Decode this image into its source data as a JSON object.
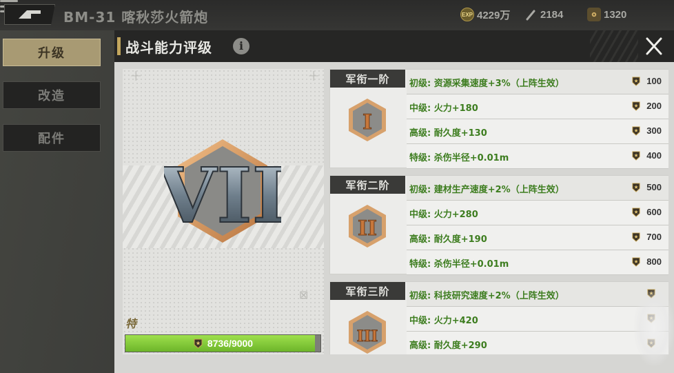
{
  "header": {
    "unit_title": "BM-31 喀秋莎火箭炮",
    "resources": {
      "exp_icon": "EXP",
      "exp_value": "4229万",
      "parts_value": "2184",
      "medal_value": "1320"
    }
  },
  "sidebar": {
    "items": [
      {
        "label": "升级",
        "active": true
      },
      {
        "label": "改造",
        "active": false
      },
      {
        "label": "配件",
        "active": false
      }
    ]
  },
  "modal": {
    "title": "战斗能力评级",
    "info_icon": "i",
    "current_rank_numeral": "VII",
    "current_rank_label": "特级",
    "progress": {
      "current": 8736,
      "max": 9000,
      "text": "8736/9000",
      "fraction": 0.9707
    },
    "tiers": [
      {
        "title": "军衔一阶",
        "numeral": "I",
        "rows": [
          {
            "text": "初级: 资源采集速度+3%（上阵生效）",
            "cost": "100"
          },
          {
            "text": "中级: 火力+180",
            "cost": "200"
          },
          {
            "text": "高级: 耐久度+130",
            "cost": "300"
          },
          {
            "text": "特级: 杀伤半径+0.01m",
            "cost": "400"
          }
        ]
      },
      {
        "title": "军衔二阶",
        "numeral": "II",
        "rows": [
          {
            "text": "初级: 建材生产速度+2%（上阵生效）",
            "cost": "500"
          },
          {
            "text": "中级: 火力+280",
            "cost": "600"
          },
          {
            "text": "高级: 耐久度+190",
            "cost": "700"
          },
          {
            "text": "特级: 杀伤半径+0.01m",
            "cost": "800"
          }
        ]
      },
      {
        "title": "军衔三阶",
        "numeral": "III",
        "rows": [
          {
            "text": "初级: 科技研究速度+2%（上阵生效）",
            "cost": ""
          },
          {
            "text": "中级: 火力+420",
            "cost": ""
          },
          {
            "text": "高级: 耐久度+290",
            "cost": ""
          }
        ]
      }
    ]
  },
  "colors": {
    "accent_gold": "#c2a65d",
    "bonus_green": "#3d7d1f",
    "progress_green": "#7cc434"
  }
}
